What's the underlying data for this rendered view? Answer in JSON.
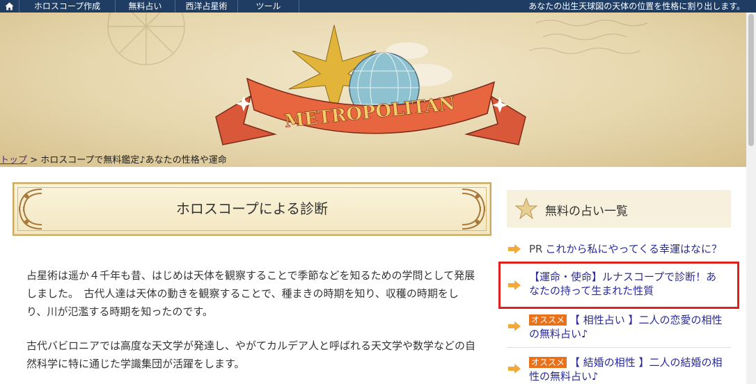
{
  "nav": {
    "home_icon": "home-icon",
    "items": [
      "ホロスコープ作成",
      "無料占い",
      "西洋占星術",
      "ツール"
    ],
    "tagline": "あなたの出生天球図の天体の位置を性格に割り出します。",
    "bg_color": "#1f3d63"
  },
  "banner": {
    "logo_text": "METROPOLITAN"
  },
  "breadcrumb": {
    "home": "トップ",
    "separator": ">",
    "current": "ホロスコープで無料鑑定♪あなたの性格や運命"
  },
  "main": {
    "heading": "ホロスコープによる診断",
    "paragraphs": [
      "占星術は遥か４千年も昔、はじめは天体を観察することで季節などを知るための学問として発展しました。　古代人達は天体の動きを観察することで、種まきの時期を知り、収穫の時期をしり、川が氾濫する時期を知ったのです。",
      "古代バビロニアでは高度な天文学が発達し、やがてカルデア人と呼ばれる天文学や数学などの自然科学に特に通じた学識集団が活躍をします。"
    ]
  },
  "sidebar": {
    "title": "無料の占い一覧",
    "items": [
      {
        "prefix": "PR",
        "badge": "",
        "text": "これから私にやってくる幸運はなに？"
      },
      {
        "prefix": "",
        "badge": "",
        "text": "【運命・使命】ルナスコープで診断！あなたの持って生まれた性質"
      },
      {
        "prefix": "",
        "badge": "オススメ",
        "text": "【 相性占い 】二人の恋愛の相性の無料占い♪"
      },
      {
        "prefix": "",
        "badge": "オススメ",
        "text": "【 結婚の相性 】二人の結婚の相性の無料占い♪"
      }
    ],
    "link_color": "#2a2a9a",
    "badge_color": "#e8711a",
    "highlight_color": "#e0201c"
  }
}
